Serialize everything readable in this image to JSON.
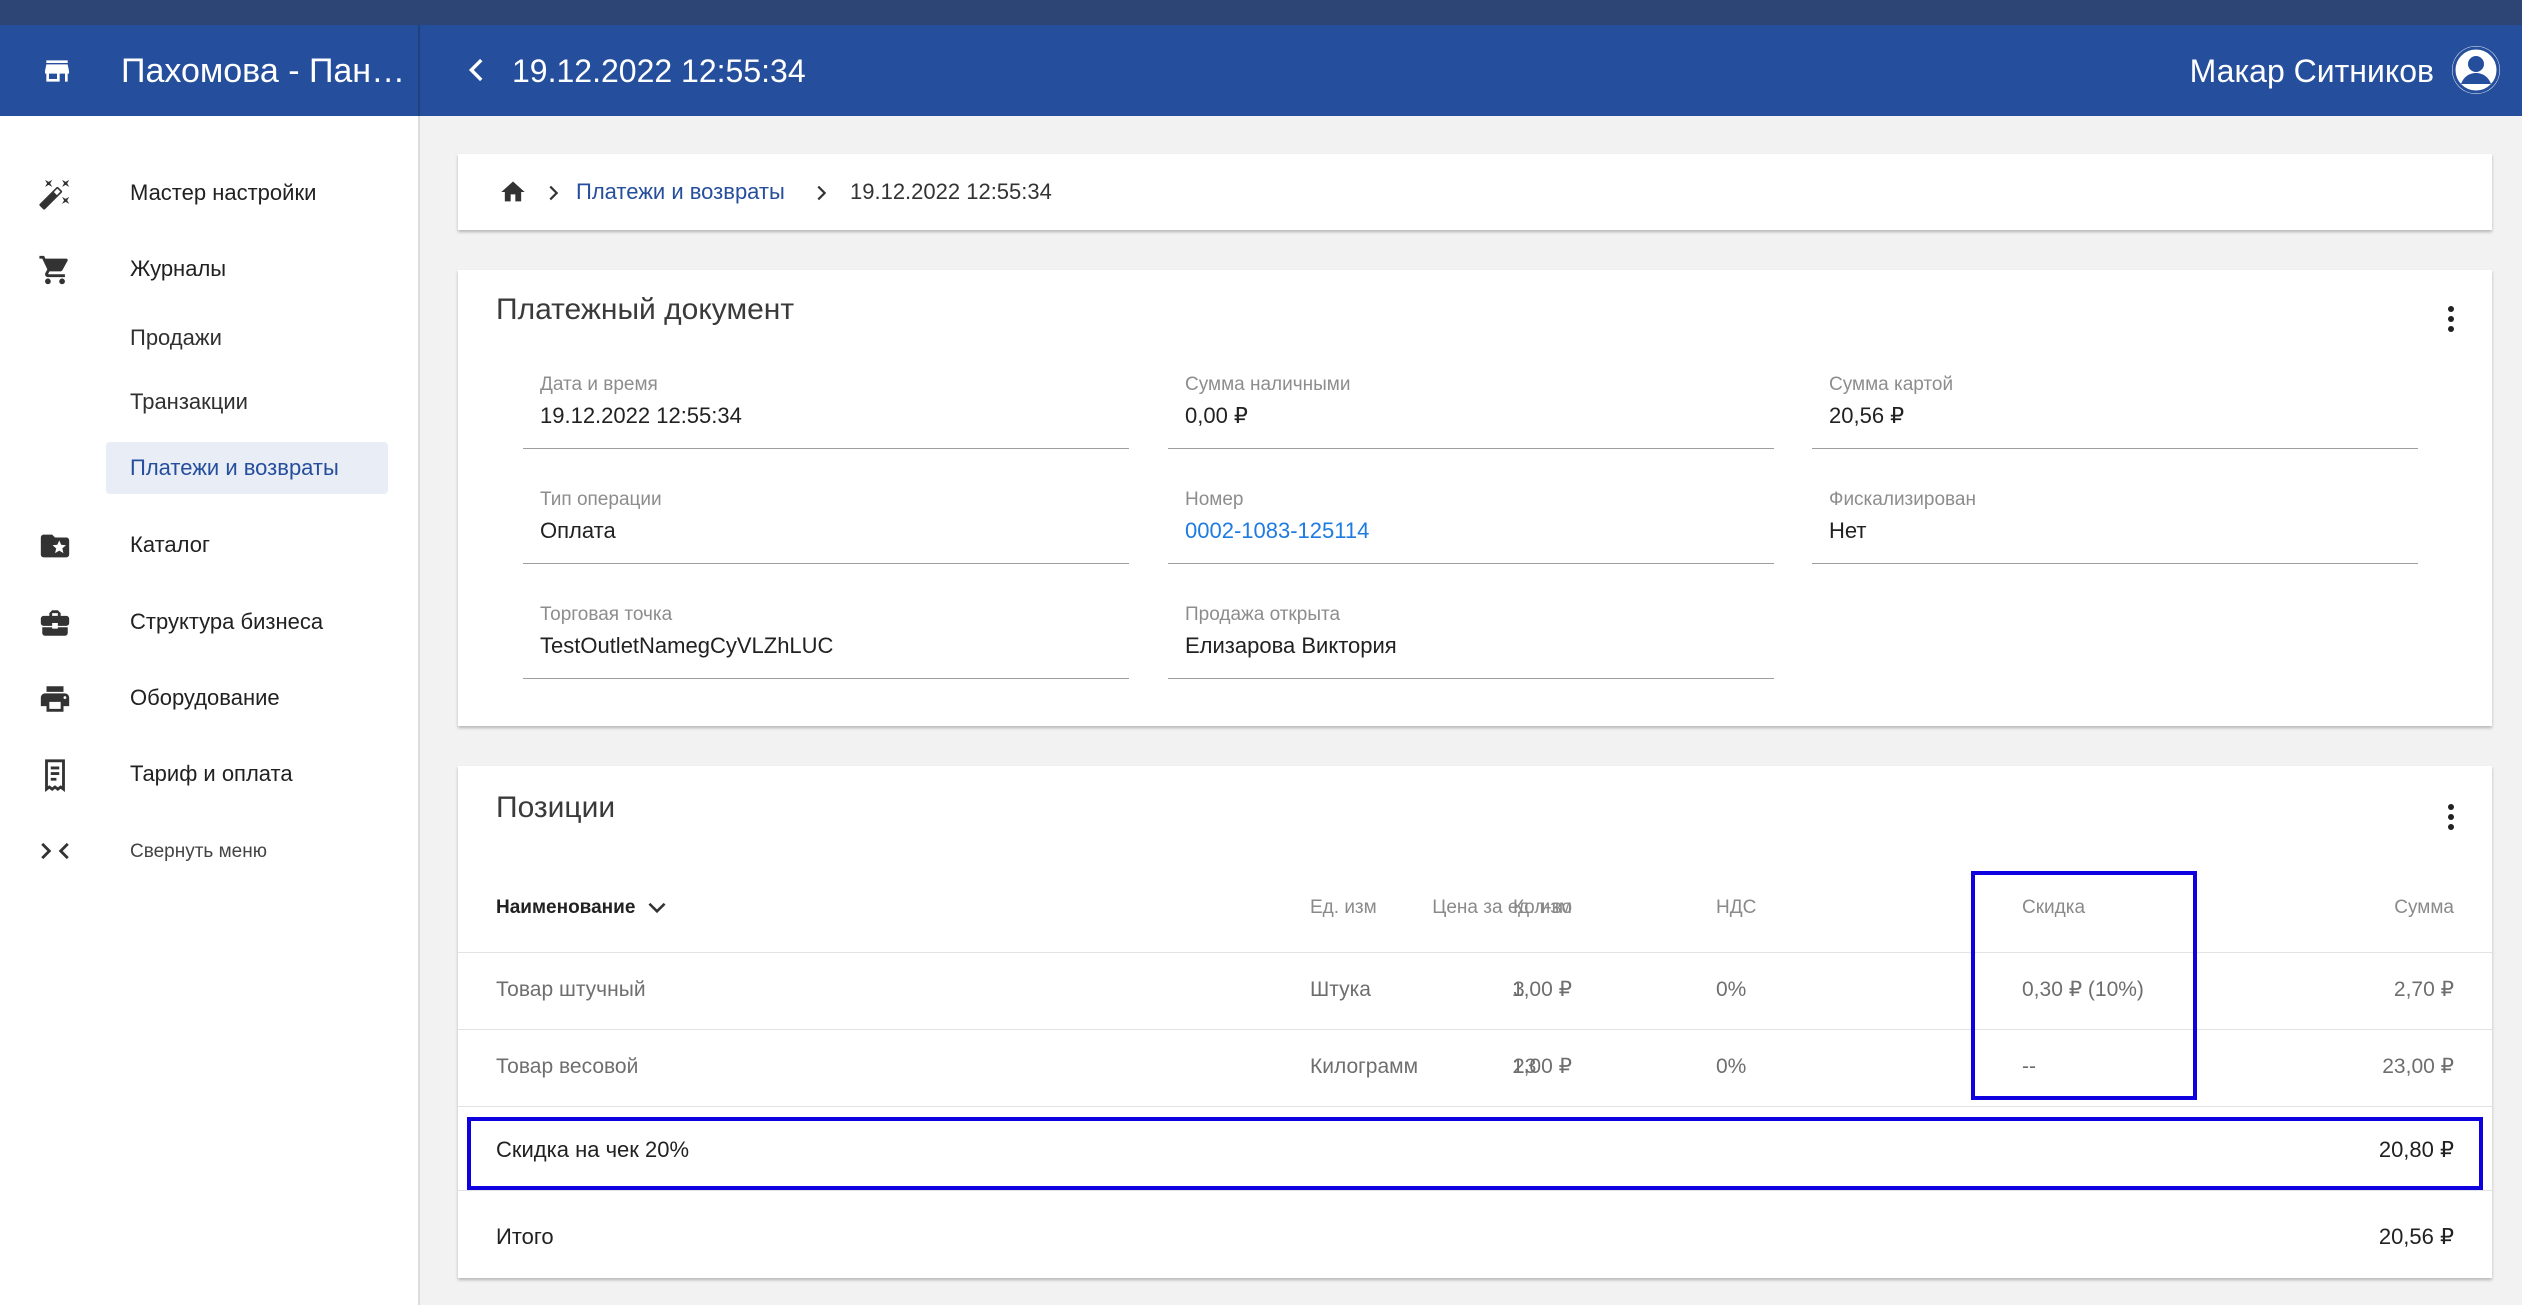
{
  "colors": {
    "appbar": "#254e9c",
    "accent": "#254e9c",
    "link": "#1e7be0",
    "highlight": "#0f00e0"
  },
  "appbar": {
    "store_icon": "store-icon",
    "org_name": "Пахомова - Пано…",
    "back_icon": "chevron-left-icon",
    "doc_title": "19.12.2022 12:55:34",
    "user_name": "Макар Ситников",
    "avatar_icon": "account-circle-icon"
  },
  "sidebar": {
    "items": [
      {
        "label": "Мастер настройки",
        "icon": "magic-wand-icon"
      },
      {
        "label": "Журналы",
        "icon": "cart-icon"
      },
      {
        "label": "Каталог",
        "icon": "folder-star-icon"
      },
      {
        "label": "Структура бизнеса",
        "icon": "briefcase-icon"
      },
      {
        "label": "Оборудование",
        "icon": "printer-icon"
      },
      {
        "label": "Тариф и оплата",
        "icon": "receipt-icon"
      },
      {
        "label": "Свернуть меню",
        "icon": "collapse-icon"
      }
    ],
    "subitems": [
      {
        "label": "Продажи"
      },
      {
        "label": "Транзакции"
      },
      {
        "label": "Платежи и возвраты",
        "active": true
      }
    ]
  },
  "breadcrumb": {
    "home_icon": "home-icon",
    "link": "Платежи и возвраты",
    "current": "19.12.2022 12:55:34"
  },
  "document": {
    "title": "Платежный документ",
    "fields": [
      {
        "label": "Дата и время",
        "value": "19.12.2022 12:55:34"
      },
      {
        "label": "Сумма наличными",
        "value": "0,00 ₽"
      },
      {
        "label": "Сумма картой",
        "value": "20,56 ₽"
      },
      {
        "label": "Тип операции",
        "value": "Оплата"
      },
      {
        "label": "Номер",
        "value": "0002-1083-125114"
      },
      {
        "label": "Фискализирован",
        "value": "Нет"
      },
      {
        "label": "Торговая точка",
        "value": "TestOutletNamegCyVLZhLUC"
      },
      {
        "label": "Продажа открыта",
        "value": "Елизарова Виктория"
      }
    ]
  },
  "positions": {
    "title": "Позиции",
    "columns": {
      "name": "Наименование",
      "price": "Цена за ед. изм",
      "unit": "Ед. изм",
      "qty": "Кол-во",
      "vat": "НДС",
      "discount": "Скидка",
      "sum": "Сумма"
    },
    "rows": [
      {
        "name": "Товар штучный",
        "price": "1,00 ₽",
        "unit": "Штука",
        "qty": "3",
        "vat": "0%",
        "discount": "0,30 ₽ (10%)",
        "sum": "2,70 ₽"
      },
      {
        "name": "Товар весовой",
        "price": "1,00 ₽",
        "unit": "Килограмм",
        "qty": "23",
        "vat": "0%",
        "discount": "--",
        "sum": "23,00 ₽"
      }
    ],
    "receipt_discount": {
      "label": "Скидка на чек 20%",
      "value": "20,80 ₽"
    },
    "total": {
      "label": "Итого",
      "value": "20,56 ₽"
    }
  }
}
